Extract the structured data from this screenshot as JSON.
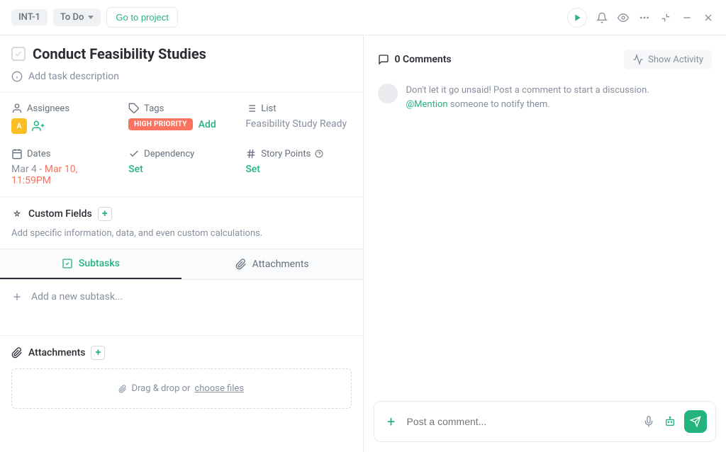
{
  "header": {
    "task_id": "INT-1",
    "status": "To Do",
    "goto_project": "Go to project"
  },
  "task": {
    "title": "Conduct Feasibility Studies",
    "description_placeholder": "Add task description"
  },
  "fields": {
    "assignees_label": "Assignees",
    "assignee_initial": "A",
    "tags_label": "Tags",
    "tag_chip": "HIGH PRIORITY",
    "tag_add": "Add",
    "list_label": "List",
    "list_value": "Feasibility Study Ready",
    "dates_label": "Dates",
    "date_start": "Mar 4",
    "date_sep": " - ",
    "date_end": "Mar 10, 11:59PM",
    "dependency_label": "Dependency",
    "dependency_value": "Set",
    "story_label": "Story Points",
    "story_value": "Set"
  },
  "custom_fields": {
    "label": "Custom Fields",
    "hint": "Add specific information, data, and even custom calculations."
  },
  "tabs": {
    "subtasks": "Subtasks",
    "attachments": "Attachments"
  },
  "subtask_add": "Add a new subtask...",
  "attachments": {
    "header": "Attachments",
    "drop_prefix": "Drag & drop or ",
    "drop_link": "choose files"
  },
  "comments": {
    "count": "0 Comments",
    "show_activity": "Show Activity",
    "empty_line1": "Don't let it go unsaid! Post a comment to start a discussion.",
    "mention": "@Mention",
    "empty_line2_rest": " someone to notify them.",
    "placeholder": "Post a comment..."
  }
}
